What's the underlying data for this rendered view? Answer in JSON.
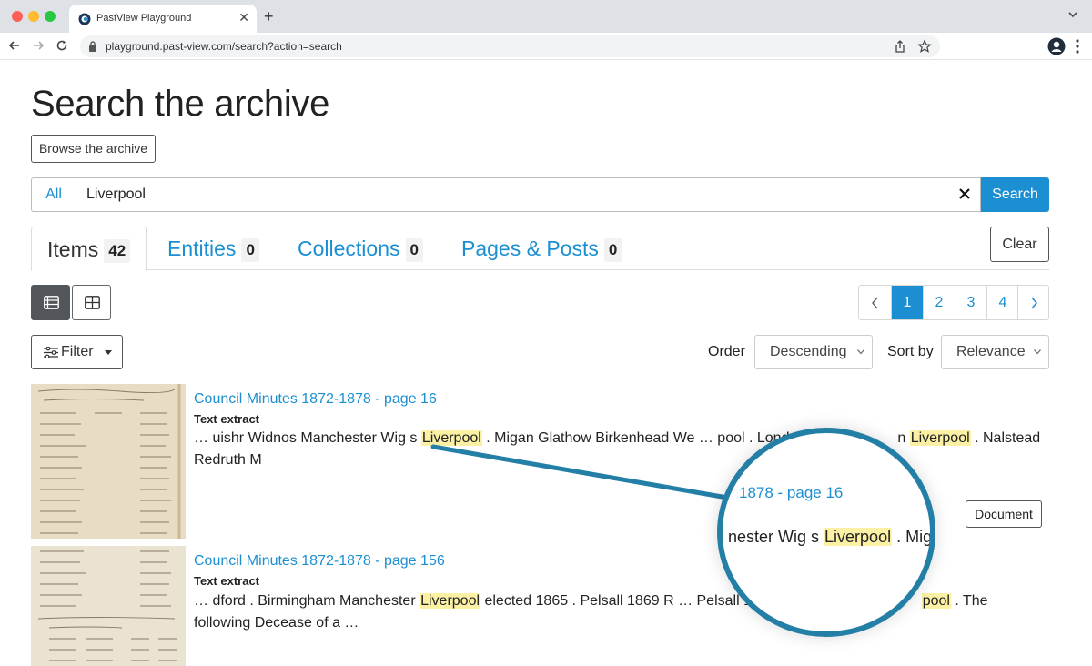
{
  "browser": {
    "tab_title": "PastView Playground",
    "url": "playground.past-view.com/search?action=search"
  },
  "page": {
    "title": "Search the archive",
    "browse_button": "Browse the archive"
  },
  "search": {
    "scope": "All",
    "query": "Liverpool",
    "button": "Search"
  },
  "tabs": [
    {
      "label": "Items",
      "count": "42",
      "active": true
    },
    {
      "label": "Entities",
      "count": "0",
      "active": false
    },
    {
      "label": "Collections",
      "count": "0",
      "active": false
    },
    {
      "label": "Pages & Posts",
      "count": "0",
      "active": false
    }
  ],
  "clear_button": "Clear",
  "view_modes": {
    "active": "list",
    "icons": [
      "list-view-icon",
      "grid-view-icon"
    ]
  },
  "pagination": {
    "pages": [
      "1",
      "2",
      "3",
      "4"
    ],
    "current": "1"
  },
  "filter_button": "Filter",
  "order": {
    "label": "Order",
    "value": "Descending"
  },
  "sort": {
    "label": "Sort by",
    "value": "Relevance"
  },
  "results": [
    {
      "title": "Council Minutes 1872-1878 - page 16",
      "type": "Text extract",
      "snippet_parts": [
        "… uishr Widnos Manchester Wig s ",
        "Liverpool",
        " . Migan Glathow Birkenhead We … pool . Londo",
        "n ",
        "Liverpool",
        " . Nalstead Redruth M"
      ]
    },
    {
      "title": "Council Minutes 1872-1878 - page 156",
      "type": "Text extract",
      "snippet_parts": [
        "… dford . Birmingham Manchester ",
        "Liverpool",
        " elected 1865 . Pelsall 1869 R … Pelsall 1869",
        "pool",
        " . The following Decease of a …"
      ]
    }
  ],
  "badge": "Document",
  "magnifier": {
    "title": "1878 - page 16",
    "snippet_before": "nester Wig s ",
    "snippet_mark": "Liverpool",
    "snippet_after": " . Miga"
  },
  "colors": {
    "link": "#1b8fd2",
    "highlight": "#fbf0a4",
    "lens_ring": "#237fa6"
  }
}
